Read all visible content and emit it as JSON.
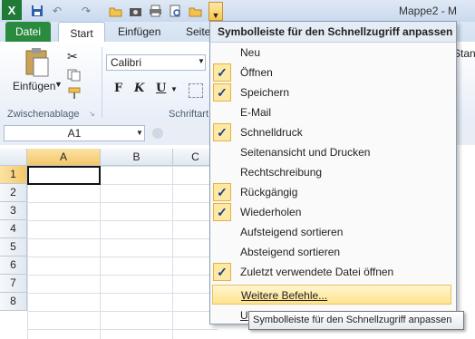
{
  "window": {
    "title": "Mappe2 - M"
  },
  "quick_access": {
    "icons": [
      "excel-app-icon",
      "save-icon",
      "undo-icon",
      "redo-icon",
      "open-folder-icon",
      "camera-icon",
      "quick-print-icon",
      "print-preview-icon",
      "folder-icon",
      "customize-dropdown-icon"
    ]
  },
  "ribbon": {
    "tabs": {
      "file": "Datei",
      "home": "Start",
      "insert": "Einfügen",
      "page": "Seite"
    },
    "right_label": "Standa",
    "clipboard": {
      "paste_label": "Einfügen",
      "group_label": "Zwischenablage"
    },
    "font": {
      "name": "Calibri",
      "group_label": "Schriftart",
      "bold": "F",
      "italic": "K",
      "underline": "U"
    }
  },
  "formula_bar": {
    "name_box": "A1"
  },
  "grid": {
    "columns": [
      "A",
      "B",
      "C"
    ],
    "rows": [
      "1",
      "2",
      "3",
      "4",
      "5",
      "6",
      "7",
      "8"
    ]
  },
  "menu": {
    "header": "Symbolleiste für den Schnellzugriff anpassen",
    "items": [
      {
        "label": "Neu",
        "checked": false
      },
      {
        "label": "Öffnen",
        "checked": true
      },
      {
        "label": "Speichern",
        "checked": true
      },
      {
        "label": "E-Mail",
        "checked": false
      },
      {
        "label": "Schnelldruck",
        "checked": true
      },
      {
        "label": "Seitenansicht und Drucken",
        "checked": false
      },
      {
        "label": "Rechtschreibung",
        "checked": false
      },
      {
        "label": "Rückgängig",
        "checked": true
      },
      {
        "label": "Wiederholen",
        "checked": true
      },
      {
        "label": "Aufsteigend sortieren",
        "checked": false
      },
      {
        "label": "Absteigend sortieren",
        "checked": false
      },
      {
        "label": "Zuletzt verwendete Datei öffnen",
        "checked": true
      },
      {
        "label": "Weitere Befehle...",
        "checked": false,
        "highlight": true
      },
      {
        "label": "U",
        "checked": false
      }
    ],
    "check_glyph": "✓"
  },
  "tooltip": {
    "text": "Symbolleiste für den Schnellzugriff anpassen"
  }
}
